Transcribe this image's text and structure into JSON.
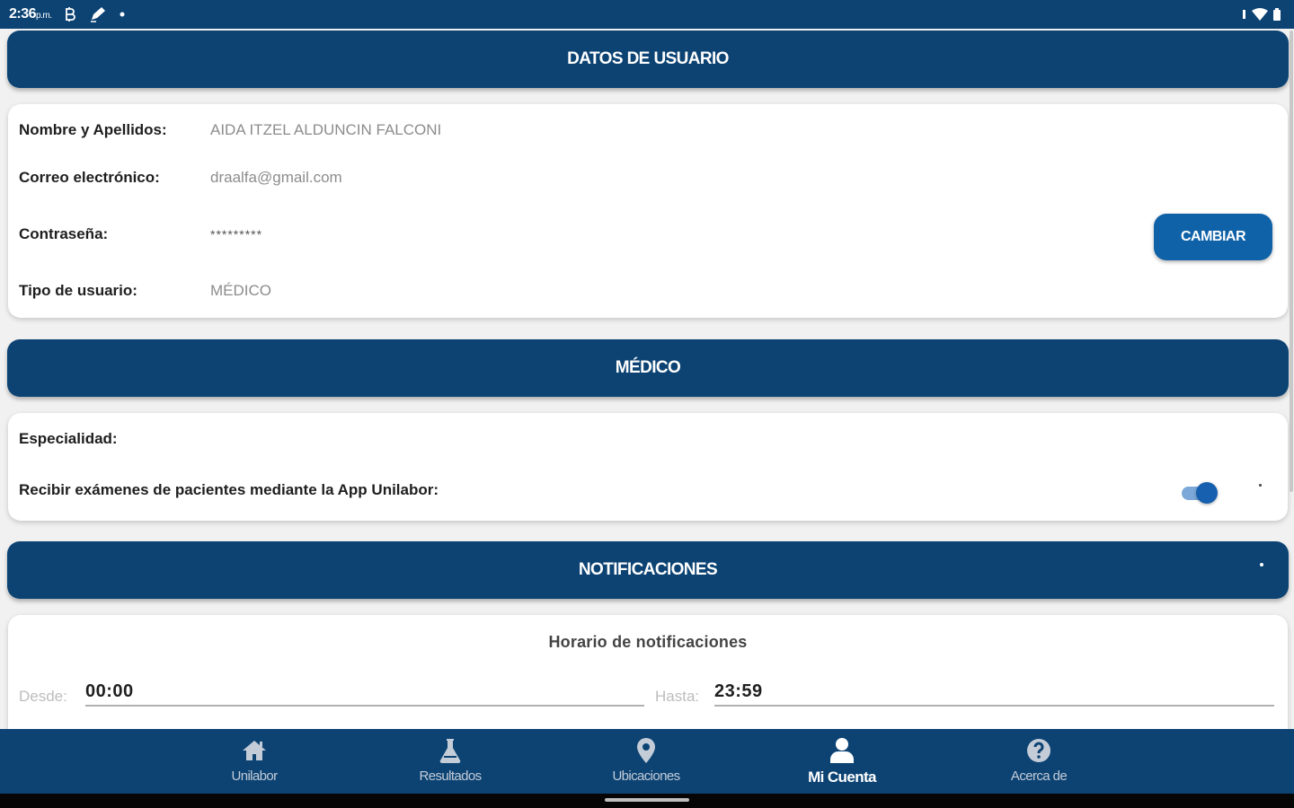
{
  "status_bar": {
    "time": "2:36",
    "ampm": "p.m."
  },
  "user_section": {
    "header": "DATOS DE USUARIO",
    "fields": [
      {
        "label": "Nombre y Apellidos:",
        "value": "AIDA ITZEL ALDUNCIN FALCONI"
      },
      {
        "label": "Correo electrónico:",
        "value": "draalfa@gmail.com"
      },
      {
        "label": "Contraseña:",
        "value": "*********"
      },
      {
        "label": "Tipo de usuario:",
        "value": "MÉDICO"
      }
    ],
    "change_button": "CAMBIAR"
  },
  "medico_section": {
    "header": "MÉDICO",
    "specialty_label": "Especialidad:",
    "receive_label": "Recibir exámenes de pacientes mediante la App Unilabor:",
    "receive_enabled": true
  },
  "notifications_section": {
    "header": "NOTIFICACIONES",
    "schedule_title": "Horario de notificaciones",
    "from_label": "Desde:",
    "from_value": "00:00",
    "to_label": "Hasta:",
    "to_value": "23:59"
  },
  "bottom_nav": {
    "items": [
      {
        "label": "Unilabor",
        "icon": "home-icon"
      },
      {
        "label": "Resultados",
        "icon": "flask-icon"
      },
      {
        "label": "Ubicaciones",
        "icon": "location-pin-icon"
      },
      {
        "label": "Mi Cuenta",
        "icon": "user-icon",
        "active": true
      },
      {
        "label": "Acerca de",
        "icon": "help-circle-icon"
      }
    ]
  },
  "colors": {
    "primary": "#0c4373",
    "button": "#0f62a8",
    "background": "#f1f1f1"
  }
}
